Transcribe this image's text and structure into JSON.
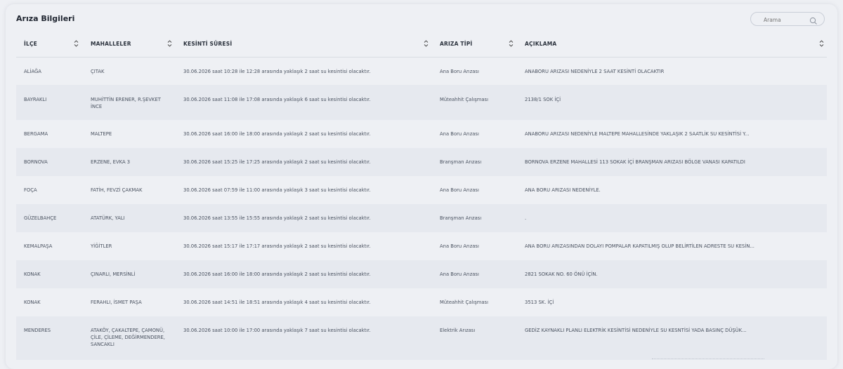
{
  "panel": {
    "title": "Arıza Bilgileri"
  },
  "search": {
    "placeholder": "Arama",
    "icon": "search-icon"
  },
  "columns": [
    {
      "key": "ilce",
      "label": "İLÇE"
    },
    {
      "key": "mahalleler",
      "label": "MAHALLELER"
    },
    {
      "key": "kesinti_suresi",
      "label": "KESİNTİ SÜRESİ"
    },
    {
      "key": "ariza_tipi",
      "label": "ARIZA TİPİ"
    },
    {
      "key": "aciklama",
      "label": "AÇIKLAMA"
    }
  ],
  "rows": [
    {
      "ilce": "ALİAĞA",
      "mahalleler": "ÇITAK",
      "kesinti_suresi": "30.06.2026 saat 10:28 ile 12:28 arasında yaklaşık 2 saat su kesintisi olacaktır.",
      "ariza_tipi": "Ana Boru Arızası",
      "aciklama": "ANABORU ARIZASI NEDENİYLE 2 SAAT KESİNTİ OLACAKTIR"
    },
    {
      "ilce": "BAYRAKLI",
      "mahalleler": "MUHİTTİN ERENER, R.ŞEVKET İNCE",
      "kesinti_suresi": "30.06.2026 saat 11:08 ile 17:08 arasında yaklaşık 6 saat su kesintisi olacaktır.",
      "ariza_tipi": "Müteahhit Çalışması",
      "aciklama": "2138/1 SOK İÇİ"
    },
    {
      "ilce": "BERGAMA",
      "mahalleler": "MALTEPE",
      "kesinti_suresi": "30.06.2026 saat 16:00 ile 18:00 arasında yaklaşık 2 saat su kesintisi olacaktır.",
      "ariza_tipi": "Ana Boru Arızası",
      "aciklama": "ANABORU ARIZASI NEDENİYLE MALTEPE MAHALLESİNDE YAKLAŞIK 2 SAATLİK SU KESİNTİSİ Y..."
    },
    {
      "ilce": "BORNOVA",
      "mahalleler": "ERZENE, EVKA 3",
      "kesinti_suresi": "30.06.2026 saat 15:25 ile 17:25 arasında yaklaşık 2 saat su kesintisi olacaktır.",
      "ariza_tipi": "Branşman Arızası",
      "aciklama": "BORNOVA ERZENE MAHALLESİ 113 SOKAK İÇİ BRANŞMAN ARIZASI BÖLGE VANASI KAPATILDI"
    },
    {
      "ilce": "FOÇA",
      "mahalleler": "FATİH, FEVZİ ÇAKMAK",
      "kesinti_suresi": "30.06.2026 saat 07:59 ile 11:00 arasında yaklaşık 3 saat su kesintisi olacaktır.",
      "ariza_tipi": "Ana Boru Arızası",
      "aciklama": "ANA BORU ARIZASI NEDENİYLE."
    },
    {
      "ilce": "GÜZELBAHÇE",
      "mahalleler": "ATATÜRK, YALI",
      "kesinti_suresi": "30.06.2026 saat 13:55 ile 15:55 arasında yaklaşık 2 saat su kesintisi olacaktır.",
      "ariza_tipi": "Branşman Arızası",
      "aciklama": "."
    },
    {
      "ilce": "KEMALPAŞA",
      "mahalleler": "YİĞİTLER",
      "kesinti_suresi": "30.06.2026 saat 15:17 ile 17:17 arasında yaklaşık 2 saat su kesintisi olacaktır.",
      "ariza_tipi": "Ana Boru Arızası",
      "aciklama": "ANA BORU ARIZASINDAN DOLAYI POMPALAR KAPATILMIŞ OLUP BELİRTİLEN ADRESTE SU KESİN..."
    },
    {
      "ilce": "KONAK",
      "mahalleler": "ÇINARLI, MERSİNLİ",
      "kesinti_suresi": "30.06.2026 saat 16:00 ile 18:00 arasında yaklaşık 2 saat su kesintisi olacaktır.",
      "ariza_tipi": "Ana Boru Arızası",
      "aciklama": "2821 SOKAK NO. 60 ÖNÜ İÇİN."
    },
    {
      "ilce": "KONAK",
      "mahalleler": "FERAHLI, İSMET PAŞA",
      "kesinti_suresi": "30.06.2026 saat 14:51 ile 18:51 arasında yaklaşık 4 saat su kesintisi olacaktır.",
      "ariza_tipi": "Müteahhit Çalışması",
      "aciklama": "3513 SK. İÇİ"
    },
    {
      "ilce": "MENDERES",
      "mahalleler": "ATAKÖY, ÇAKALTEPE, ÇAMONÜ, ÇİLE, ÇİLEME, DEĞİRMENDERE, SANCAKLI",
      "kesinti_suresi": "30.06.2026 saat 10:00 ile 17:00 arasında yaklaşık 7 saat su kesintisi olacaktır.",
      "ariza_tipi": "Elektrik Arızası",
      "aciklama": "GEDİZ KAYNAKLI PLANLI ELEKTRİK KESİNTİSİ NEDENİYLE SU KESNTİSİ YADA BASINÇ DÜŞÜK..."
    }
  ]
}
